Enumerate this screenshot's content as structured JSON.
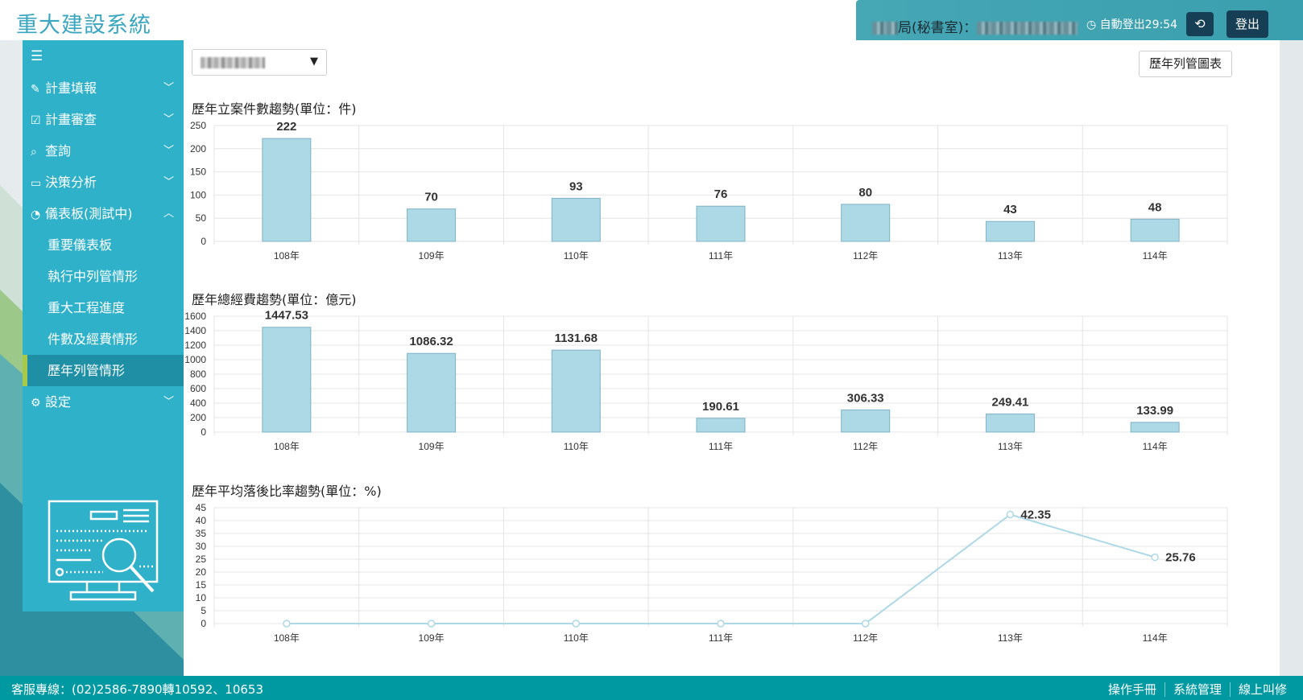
{
  "header": {
    "app_title": "重大建設系統",
    "user_office_suffix": "局(秘書室)：",
    "auto_logout": "自動登出29:54",
    "logout_label": "登出"
  },
  "sidebar": {
    "items": [
      {
        "label": "計畫填報",
        "icon": "edit-icon",
        "expanded": false
      },
      {
        "label": "計畫審查",
        "icon": "check-square-icon",
        "expanded": false
      },
      {
        "label": "查詢",
        "icon": "search-icon",
        "expanded": false
      },
      {
        "label": "決策分析",
        "icon": "monitor-icon",
        "expanded": false
      },
      {
        "label": "儀表板(測試中)",
        "icon": "dashboard-icon",
        "expanded": true
      }
    ],
    "sub_items": [
      "重要儀表板",
      "執行中列管情形",
      "重大工程進度",
      "件數及經費情形",
      "歷年列管情形"
    ],
    "active_sub": "歷年列管情形",
    "settings_label": "設定"
  },
  "main": {
    "chart_button": "歷年列管圖表"
  },
  "chart_data": [
    {
      "type": "bar",
      "title": "歷年立案件數趨勢(單位：件)",
      "categories": [
        "108年",
        "109年",
        "110年",
        "111年",
        "112年",
        "113年",
        "114年"
      ],
      "values": [
        222,
        70,
        93,
        76,
        80,
        43,
        48
      ],
      "value_labels": [
        "222",
        "70",
        "93",
        "76",
        "80",
        "43",
        "48"
      ],
      "ylim": [
        0,
        250
      ],
      "yticks": [
        0,
        50,
        100,
        150,
        200,
        250
      ],
      "bar_color": "#add8e6",
      "grid": true
    },
    {
      "type": "bar",
      "title": "歷年總經費趨勢(單位：億元)",
      "categories": [
        "108年",
        "109年",
        "110年",
        "111年",
        "112年",
        "113年",
        "114年"
      ],
      "values": [
        1447.53,
        1086.32,
        1131.68,
        190.61,
        306.33,
        249.41,
        133.99
      ],
      "value_labels": [
        "1447.53",
        "1086.32",
        "1131.68",
        "190.61",
        "306.33",
        "249.41",
        "133.99"
      ],
      "ylim": [
        0,
        1600
      ],
      "yticks": [
        0,
        200,
        400,
        600,
        800,
        1000,
        1200,
        1400,
        1600
      ],
      "bar_color": "#add8e6",
      "grid": true
    },
    {
      "type": "line",
      "title": "歷年平均落後比率趨勢(單位：%)",
      "categories": [
        "108年",
        "109年",
        "110年",
        "111年",
        "112年",
        "113年",
        "114年"
      ],
      "values": [
        0,
        0,
        0,
        0,
        0,
        42.35,
        25.76
      ],
      "value_labels": [
        "",
        "",
        "",
        "",
        "",
        "42.35",
        "25.76"
      ],
      "ylim": [
        0,
        45
      ],
      "yticks": [
        0,
        5,
        10,
        15,
        20,
        25,
        30,
        35,
        40,
        45
      ],
      "line_color": "#add8e6",
      "grid": true
    }
  ],
  "footer": {
    "service_line": "客服專線：(02)2586-7890轉10592、10653",
    "links": [
      "操作手冊",
      "系統管理",
      "線上叫修"
    ]
  }
}
